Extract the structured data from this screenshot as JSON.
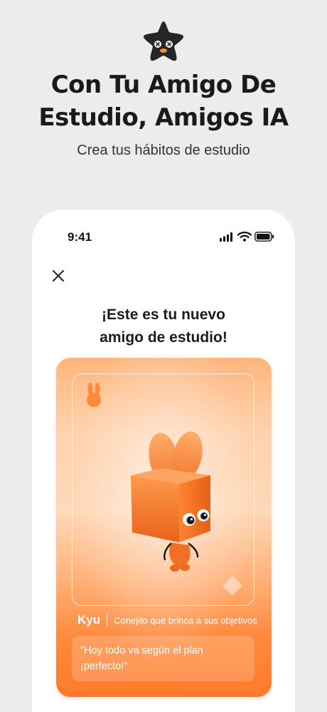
{
  "headline": {
    "line1": "Con Tu Amigo De",
    "line2": "Estudio, Amigos IA"
  },
  "subtitle": "Crea tus hábitos de estudio",
  "status_bar": {
    "time": "9:41"
  },
  "sheet": {
    "title_line1": "¡Este es tu nuevo",
    "title_line2": "amigo de estudio!"
  },
  "card": {
    "name": "Kyu",
    "description": "Conejito que brinca a sus objetivos",
    "quote_line1": "\"Hoy todo va según el plan",
    "quote_line2": "¡perfecto!\""
  },
  "colors": {
    "accent": "#ff7a2a",
    "background": "#ececec",
    "text_dark": "#1a1a1a"
  },
  "icons": {
    "logo": "star-mascot-icon",
    "close": "close-icon",
    "signal": "signal-icon",
    "wifi": "wifi-icon",
    "battery": "battery-icon",
    "badge": "bunny-icon",
    "decoration": "diamond-icon"
  }
}
